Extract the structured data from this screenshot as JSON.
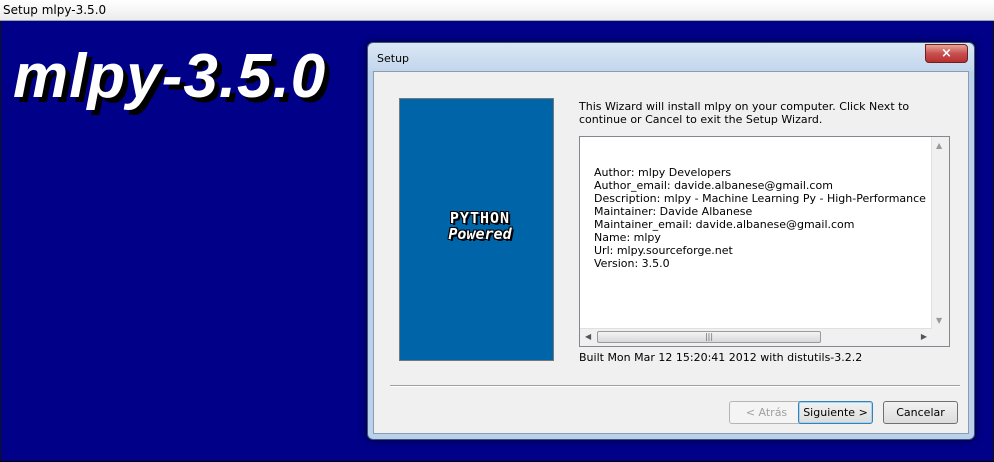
{
  "outer_window": {
    "title": "Setup mlpy-3.5.0"
  },
  "banner": {
    "title": "mlpy-3.5.0"
  },
  "dialog": {
    "title": "Setup",
    "close_symbol": "×",
    "logo": {
      "line1": "PYTHON",
      "line2": "Powered"
    },
    "intro": "This Wizard will install mlpy on your computer. Click Next to continue or Cancel to exit the Setup Wizard.",
    "info_lines": [
      "Author: mlpy Developers",
      "Author_email: davide.albanese@gmail.com",
      "Description: mlpy - Machine Learning Py - High-Performance Python Pa",
      "Maintainer: Davide Albanese",
      "Maintainer_email: davide.albanese@gmail.com",
      "Name: mlpy",
      "Url: mlpy.sourceforge.net",
      "Version: 3.5.0"
    ],
    "built": "Built Mon Mar 12 15:20:41 2012 with distutils-3.2.2",
    "buttons": {
      "back": "< Atrás",
      "next": "Siguiente >",
      "cancel": "Cancelar"
    }
  },
  "icons": [
    "close-icon",
    "scroll-up-arrow-icon",
    "scroll-down-arrow-icon",
    "scroll-left-arrow-icon",
    "scroll-right-arrow-icon",
    "python-powered-logo"
  ],
  "colors": {
    "backdrop": "#000088",
    "side_image": "#0064a8",
    "close_button": "#c75050"
  }
}
